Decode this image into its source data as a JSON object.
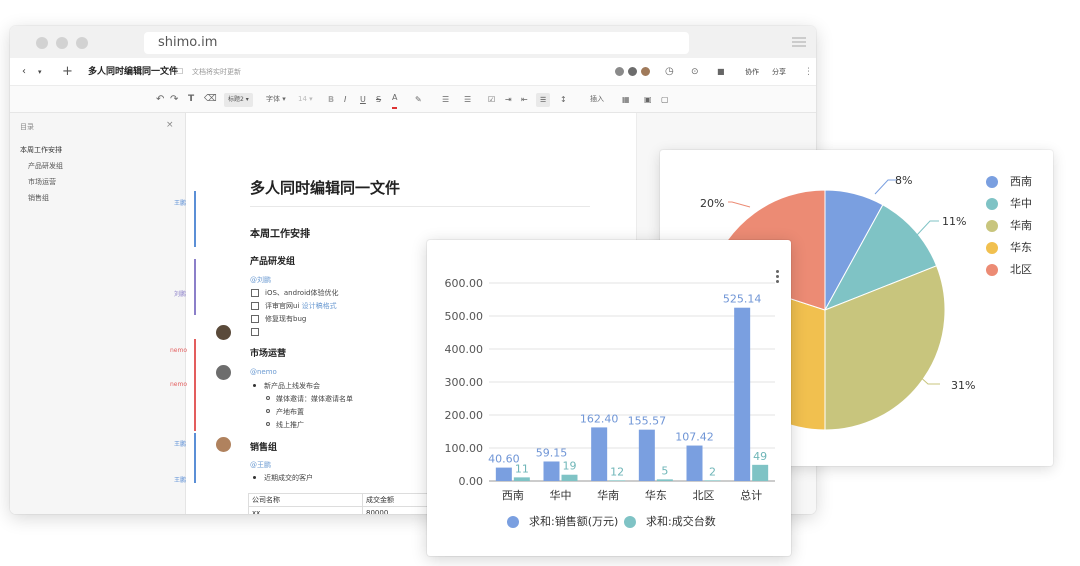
{
  "browser": {
    "url": "shimo.im",
    "doc_title": "多人同时编辑同一文件",
    "status": "文档将实时更新",
    "collab_label": "协作",
    "share_label": "分享"
  },
  "toolbar": {
    "heading_select": "标题2",
    "font_select": "字体",
    "size_select": "14",
    "insert_label": "插入"
  },
  "sidebar": {
    "title": "目录",
    "items": [
      "本周工作安排",
      "产品研发组",
      "市场运营",
      "销售组"
    ]
  },
  "gutter": {
    "labels": [
      "王鹏",
      "刘鹏",
      "nemo",
      "nemo",
      "王鹏",
      "王鹏"
    ]
  },
  "doc": {
    "heading": "多人同时编辑同一文件",
    "section_title": "本周工作安排",
    "group1": {
      "title": "产品研发组",
      "mention": "@刘鹏",
      "tasks": [
        "iOS、android体验优化",
        "评审官网ui",
        "修复现有bug",
        ""
      ],
      "link": "设计稿格式"
    },
    "group2": {
      "title": "市场运营",
      "mention": "@nemo",
      "item": "新产品上线发布会",
      "subitems": [
        "媒体邀请：媒体邀请名单",
        "产地布置",
        "线上推广"
      ]
    },
    "group3": {
      "title": "销售组",
      "mention": "@王鹏",
      "item": "近期成交的客户"
    },
    "table": {
      "headers": [
        "公司名称",
        "成交金额"
      ],
      "row": [
        "xx",
        "80000"
      ]
    }
  },
  "pie": {
    "legend": [
      "西南",
      "华中",
      "华南",
      "华东",
      "北区"
    ],
    "labels": [
      "8%",
      "11%",
      "31%",
      "20%"
    ],
    "colors": [
      "#7a9fe0",
      "#7fc3c5",
      "#c8c57d",
      "#f1c04f",
      "#ec8b74"
    ]
  },
  "chart_data": {
    "type": "bar",
    "categories": [
      "西南",
      "华中",
      "华南",
      "华东",
      "北区",
      "总计"
    ],
    "series": [
      {
        "name": "求和:销售额(万元)",
        "values": [
          40.6,
          59.15,
          162.4,
          155.57,
          107.42,
          525.14
        ],
        "labels": [
          "40.60",
          "59.15",
          "162.40",
          "155.57",
          "107.42",
          "525.14"
        ],
        "color": "#7a9fe0"
      },
      {
        "name": "求和:成交台数",
        "values": [
          11,
          19,
          2,
          5,
          2,
          49
        ],
        "labels": [
          "11",
          "19",
          "12",
          "5",
          "2",
          "49"
        ],
        "color": "#7fc3c5"
      }
    ],
    "yticks": [
      "0.00",
      "100.00",
      "200.00",
      "300.00",
      "400.00",
      "500.00",
      "600.00"
    ],
    "ylim": [
      0,
      600
    ],
    "grid": true,
    "legend_position": "bottom"
  }
}
